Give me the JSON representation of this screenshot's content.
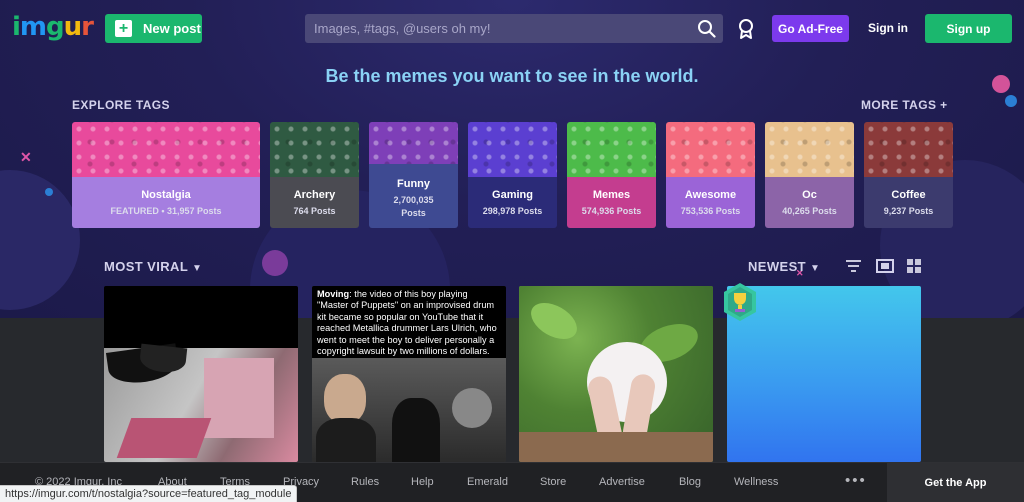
{
  "header": {
    "logo_letters": [
      "i",
      "m",
      "g",
      "u",
      "r"
    ],
    "logo_colors": [
      "#1bb76e",
      "#2196f3",
      "#1bb76e",
      "#f2b90f",
      "#e6543a"
    ],
    "new_post": "New post",
    "search_placeholder": "Images, #tags, @users oh my!",
    "ad_free": "Go Ad-Free",
    "sign_in": "Sign in",
    "sign_up": "Sign up"
  },
  "hero": {
    "tagline": "Be the memes you want to see in the world.",
    "explore_tags": "EXPLORE TAGS",
    "more_tags": "MORE TAGS +"
  },
  "tags": [
    {
      "name": "Nostalgia",
      "posts": "FEATURED • 31,957 Posts",
      "color": "#a57ee0",
      "art": "#e84a9c"
    },
    {
      "name": "Archery",
      "posts": "764 Posts",
      "color": "#4b4b52",
      "art": "#2f5a42"
    },
    {
      "name": "Funny",
      "posts": "2,700,035 Posts",
      "color": "#3e4a92",
      "art": "#7e3fb8"
    },
    {
      "name": "Gaming",
      "posts": "298,978 Posts",
      "color": "#2b2b78",
      "art": "#5b3fd1"
    },
    {
      "name": "Memes",
      "posts": "574,936 Posts",
      "color": "#c43d8f",
      "art": "#4dbb4a"
    },
    {
      "name": "Awesome",
      "posts": "753,536 Posts",
      "color": "#9b64d7",
      "art": "#f46b7e"
    },
    {
      "name": "Oc",
      "posts": "40,265 Posts",
      "color": "#8c64a8",
      "art": "#e8c18e"
    },
    {
      "name": "Coffee",
      "posts": "9,237 Posts",
      "color": "#3c3b6e",
      "art": "#8b3a3a"
    }
  ],
  "feed": {
    "most_viral": "MOST VIRAL",
    "newest": "NEWEST",
    "card2_bold": "Moving",
    "card2_text": ": the video of this boy playing \"Master of Puppets\" on an improvised drum kit became so popular on YouTube that it reached Metallica drummer Lars Ulrich, who went to meet the boy to deliver personally a copyright lawsuit by two millions of dollars."
  },
  "footer": {
    "copyright": "© 2022 Imgur, Inc",
    "links": [
      "About",
      "Terms",
      "Privacy",
      "Rules",
      "Help",
      "Emerald",
      "Store",
      "Advertise",
      "Blog",
      "Wellness"
    ],
    "more": "•••",
    "get_app": "Get the App"
  },
  "status_url": "https://imgur.com/t/nostalgia?source=featured_tag_module"
}
